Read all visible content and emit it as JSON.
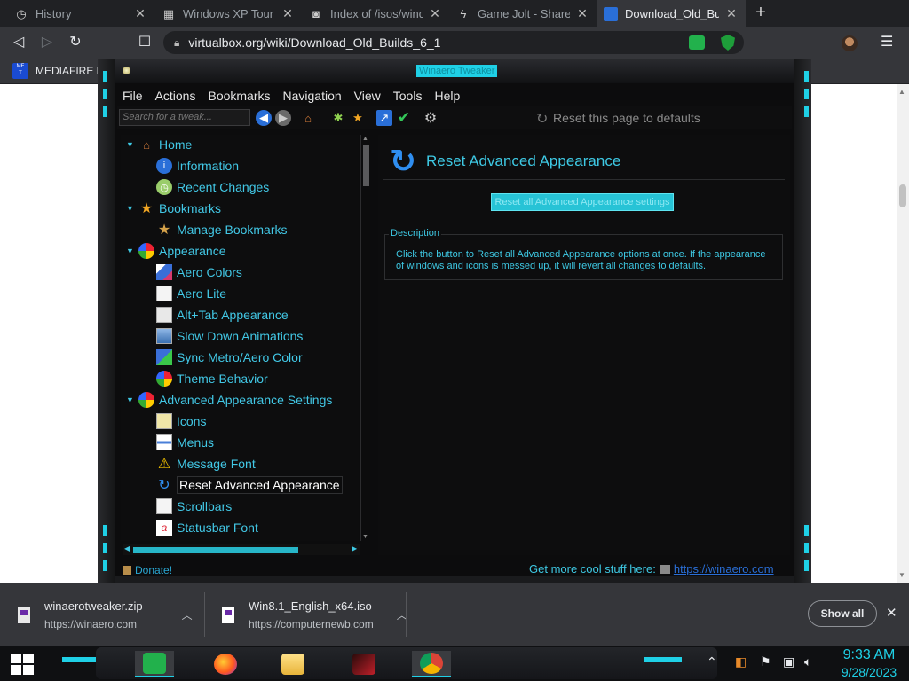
{
  "browser": {
    "tabs": [
      {
        "label": "History",
        "favicon": "clock-icon",
        "active": false
      },
      {
        "label": "Windows XP Tour : M",
        "favicon": "archive-icon",
        "active": false
      },
      {
        "label": "Index of /isos/windo",
        "favicon": "document-icon",
        "active": false
      },
      {
        "label": "Game Jolt - Share yo",
        "favicon": "lightning-icon",
        "active": false
      },
      {
        "label": "Download_Old_Builds",
        "favicon": "virtualbox-icon",
        "active": true
      }
    ],
    "url": "virtualbox.org/wiki/Download_Old_Builds_6_1",
    "bookmarks": [
      {
        "label": "MEDIAFIRE RO",
        "icon": "mediafire-icon"
      }
    ]
  },
  "app": {
    "title": "Winaero Tweaker",
    "menu": [
      "File",
      "Actions",
      "Bookmarks",
      "Navigation",
      "View",
      "Tools",
      "Help"
    ],
    "search_placeholder": "Search for a tweak...",
    "reset_page_label": "Reset this page to defaults",
    "tree": [
      {
        "label": "Home",
        "level": 0,
        "icon": "home-icon"
      },
      {
        "label": "Information",
        "level": 1,
        "icon": "info-icon"
      },
      {
        "label": "Recent Changes",
        "level": 1,
        "icon": "recent-icon"
      },
      {
        "label": "Bookmarks",
        "level": 0,
        "icon": "star-icon"
      },
      {
        "label": "Manage Bookmarks",
        "level": 1,
        "icon": "star-icon"
      },
      {
        "label": "Appearance",
        "level": 0,
        "icon": "palette-icon"
      },
      {
        "label": "Aero Colors",
        "level": 1,
        "icon": "color-icon"
      },
      {
        "label": "Aero Lite",
        "level": 1,
        "icon": "window-icon"
      },
      {
        "label": "Alt+Tab Appearance",
        "level": 1,
        "icon": "window-icon"
      },
      {
        "label": "Slow Down Animations",
        "level": 1,
        "icon": "window-icon"
      },
      {
        "label": "Sync Metro/Aero Color",
        "level": 1,
        "icon": "sync-icon"
      },
      {
        "label": "Theme Behavior",
        "level": 1,
        "icon": "palette-icon"
      },
      {
        "label": "Advanced Appearance Settings",
        "level": 0,
        "icon": "palette-icon"
      },
      {
        "label": "Icons",
        "level": 1,
        "icon": "icons-icon"
      },
      {
        "label": "Menus",
        "level": 1,
        "icon": "menus-icon"
      },
      {
        "label": "Message Font",
        "level": 1,
        "icon": "warning-icon"
      },
      {
        "label": "Reset Advanced Appearance",
        "level": 1,
        "icon": "reset-icon",
        "selected": true
      },
      {
        "label": "Scrollbars",
        "level": 1,
        "icon": "scrollbar-icon"
      },
      {
        "label": "Statusbar Font",
        "level": 1,
        "icon": "font-icon"
      }
    ],
    "right": {
      "title": "Reset Advanced Appearance",
      "button": "Reset all Advanced Appearance settings",
      "desc_label": "Description",
      "desc_text": "Click the button to Reset all Advanced Appearance options at once. If the appearance of windows and icons is messed up, it will revert all changes to defaults."
    },
    "footer": {
      "donate": "Donate!",
      "cool_stuff": "Get more cool stuff here:",
      "link": "https://winaero.com"
    }
  },
  "downloads": [
    {
      "name": "winaerotweaker.zip",
      "source": "https://winaero.com"
    },
    {
      "name": "Win8.1_English_x64.iso",
      "source": "https://computernewb.com"
    }
  ],
  "downloads_show_all": "Show all",
  "taskbar": {
    "time": "9:33 AM",
    "date": "9/28/2023"
  },
  "colors": {
    "accent_cyan": "#1fd0e6",
    "tree_text": "#42c8e6",
    "browser_dark": "#35363a"
  }
}
